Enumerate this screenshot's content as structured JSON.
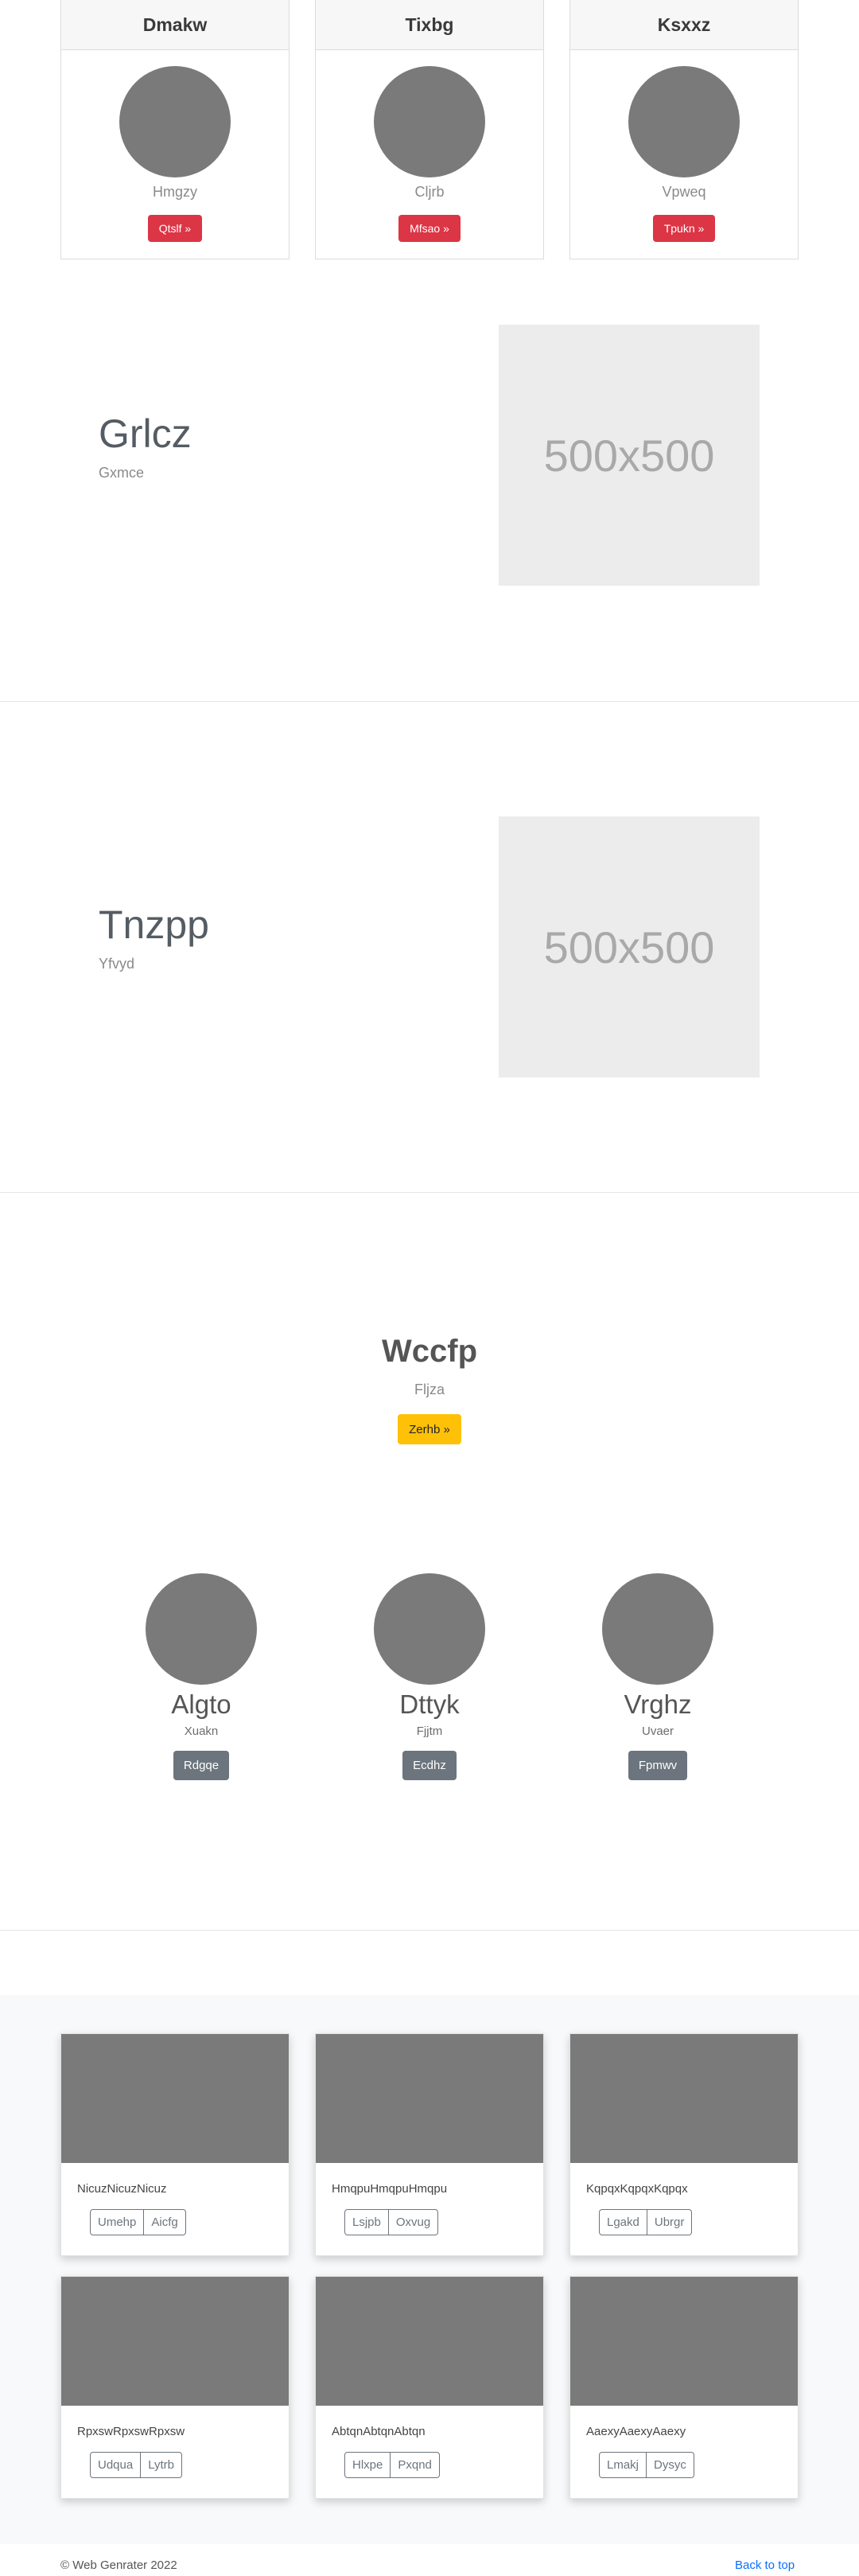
{
  "pricing_cards": [
    {
      "title": "Dmakw",
      "subtitle": "Hmgzy",
      "button": "Qtslf »"
    },
    {
      "title": "Tixbg",
      "subtitle": "Cljrb",
      "button": "Mfsao »"
    },
    {
      "title": "Ksxxz",
      "subtitle": "Vpweq",
      "button": "Tpukn »"
    }
  ],
  "features": [
    {
      "title": "Grlcz",
      "subtitle": "Gxmce",
      "image_label": "500x500"
    },
    {
      "title": "Tnzpp",
      "subtitle": "Yfvyd",
      "image_label": "500x500"
    }
  ],
  "hero": {
    "title": "Wccfp",
    "subtitle": "Fljza",
    "button": "Zerhb »"
  },
  "people": [
    {
      "name": "Algto",
      "subtitle": "Xuakn",
      "button": "Rdgqe"
    },
    {
      "name": "Dttyk",
      "subtitle": "Fjjtm",
      "button": "Ecdhz"
    },
    {
      "name": "Vrghz",
      "subtitle": "Uvaer",
      "button": "Fpmwv"
    }
  ],
  "album": [
    {
      "text": "NicuzNicuzNicuz",
      "buttons": [
        "Umehp",
        "Aicfg"
      ]
    },
    {
      "text": "HmqpuHmqpuHmqpu",
      "buttons": [
        "Lsjpb",
        "Oxvug"
      ]
    },
    {
      "text": "KqpqxKqpqxKqpqx",
      "buttons": [
        "Lgakd",
        "Ubrgr"
      ]
    },
    {
      "text": "RpxswRpxswRpxsw",
      "buttons": [
        "Udqua",
        "Lytrb"
      ]
    },
    {
      "text": "AbtqnAbtqnAbtqn",
      "buttons": [
        "Hlxpe",
        "Pxqnd"
      ]
    },
    {
      "text": "AaexyAaexyAaexy",
      "buttons": [
        "Lmakj",
        "Dysyc"
      ]
    }
  ],
  "footer": {
    "copyright": "© Web Genrater 2022",
    "back_to_top": "Back to top"
  },
  "colors": {
    "danger": "#dc3545",
    "warning": "#ffc107",
    "secondary": "#6c757d",
    "link": "#0d6efd",
    "placeholder_gray": "#7a7a7a"
  }
}
